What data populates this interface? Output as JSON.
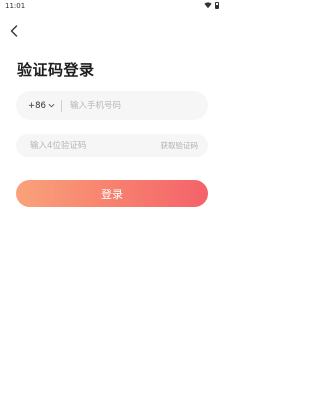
{
  "status_bar": {
    "time": "11:01"
  },
  "header": {
    "title": "验证码登录"
  },
  "phone": {
    "country_code": "+86",
    "placeholder": "输入手机号码",
    "value": ""
  },
  "code": {
    "placeholder": "输入4位验证码",
    "value": "",
    "get_code_label": "获取验证码"
  },
  "login": {
    "label": "登录"
  },
  "colors": {
    "accent_start": "#f9a27a",
    "accent_end": "#f4626a",
    "field_bg": "#f6f6f6"
  }
}
